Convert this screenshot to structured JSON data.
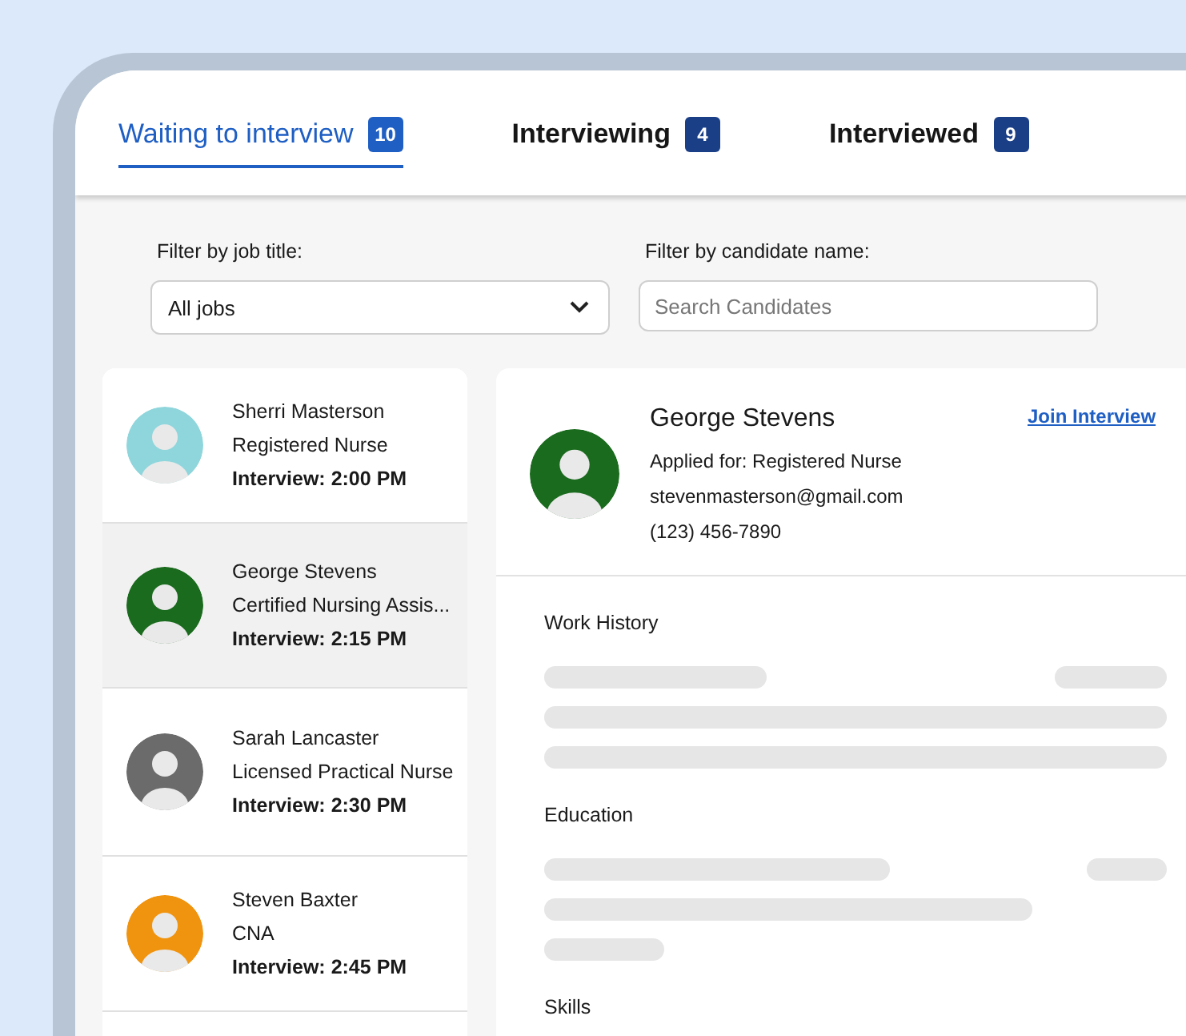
{
  "tabs": [
    {
      "label": "Waiting to interview",
      "count": "10",
      "selected": true
    },
    {
      "label": "Interviewing",
      "count": "4",
      "selected": false
    },
    {
      "label": "Interviewed",
      "count": "9",
      "selected": false
    }
  ],
  "filters": {
    "job_label": "Filter by job title:",
    "job_value": "All jobs",
    "name_label": "Filter by candidate name:",
    "name_placeholder": "Search Candidates"
  },
  "candidates": [
    {
      "name": "Sherri Masterson",
      "role": "Registered Nurse",
      "interview": "Interview: 2:00 PM",
      "color": "#8fd6dc",
      "selected": false
    },
    {
      "name": "George Stevens",
      "role": "Certified Nursing Assis...",
      "interview": "Interview: 2:15 PM",
      "color": "#1b6b1f",
      "selected": true
    },
    {
      "name": "Sarah Lancaster",
      "role": "Licensed Practical Nurse",
      "interview": "Interview: 2:30 PM",
      "color": "#6b6b6b",
      "selected": false
    },
    {
      "name": "Steven Baxter",
      "role": "CNA",
      "interview": "Interview: 2:45 PM",
      "color": "#f0940f",
      "selected": false
    }
  ],
  "detail": {
    "name": "George Stevens",
    "applied": "Applied for: Registered Nurse",
    "email": "stevenmasterson@gmail.com",
    "phone": "(123) 456-7890",
    "color": "#1b6b1f",
    "join": "Join Interview",
    "sections": [
      {
        "title": "Work History"
      },
      {
        "title": "Education"
      },
      {
        "title": "Skills"
      }
    ]
  }
}
